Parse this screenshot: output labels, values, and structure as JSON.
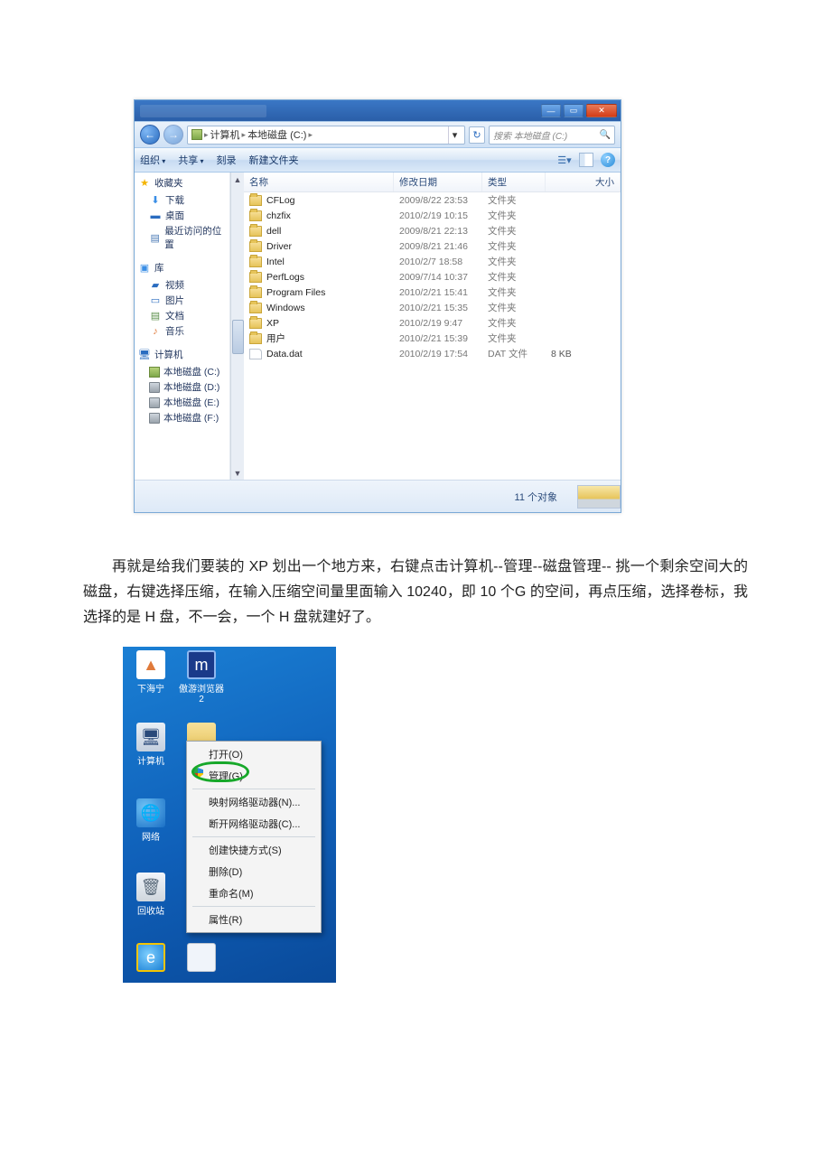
{
  "explorer": {
    "window_controls": {
      "min": "—",
      "max": "▭",
      "close": "✕"
    },
    "nav": {
      "back": "←",
      "forward": "→"
    },
    "breadcrumb": {
      "sep": "▸",
      "seg_computer": "计算机",
      "seg_drive": "本地磁盘 (C:)",
      "seg_trail": "▸",
      "dropdown": "▾",
      "refresh": "↻"
    },
    "search": {
      "placeholder": "搜索 本地磁盘 (C:)",
      "icon": "🔍"
    },
    "toolbar": {
      "organize": "组织",
      "share": "共享",
      "burn": "刻录",
      "new_folder": "新建文件夹",
      "view_icon": "☰▾",
      "help_icon": "?"
    },
    "nav_pane": {
      "favorites": {
        "label": "收藏夹",
        "items": [
          "下载",
          "桌面",
          "最近访问的位置"
        ]
      },
      "libraries": {
        "label": "库",
        "items": [
          "视频",
          "图片",
          "文档",
          "音乐"
        ]
      },
      "computer": {
        "label": "计算机",
        "drives": [
          "本地磁盘 (C:)",
          "本地磁盘 (D:)",
          "本地磁盘 (E:)",
          "本地磁盘 (F:)"
        ]
      }
    },
    "columns": {
      "name": "名称",
      "date": "修改日期",
      "type": "类型",
      "size": "大小"
    },
    "rows": [
      {
        "name": "CFLog",
        "date": "2009/8/22 23:53",
        "type": "文件夹",
        "size": "",
        "kind": "folder"
      },
      {
        "name": "chzfix",
        "date": "2010/2/19 10:15",
        "type": "文件夹",
        "size": "",
        "kind": "folder"
      },
      {
        "name": "dell",
        "date": "2009/8/21 22:13",
        "type": "文件夹",
        "size": "",
        "kind": "folder"
      },
      {
        "name": "Driver",
        "date": "2009/8/21 21:46",
        "type": "文件夹",
        "size": "",
        "kind": "folder"
      },
      {
        "name": "Intel",
        "date": "2010/2/7 18:58",
        "type": "文件夹",
        "size": "",
        "kind": "folder"
      },
      {
        "name": "PerfLogs",
        "date": "2009/7/14 10:37",
        "type": "文件夹",
        "size": "",
        "kind": "folder"
      },
      {
        "name": "Program Files",
        "date": "2010/2/21 15:41",
        "type": "文件夹",
        "size": "",
        "kind": "folder"
      },
      {
        "name": "Windows",
        "date": "2010/2/21 15:35",
        "type": "文件夹",
        "size": "",
        "kind": "folder"
      },
      {
        "name": "XP",
        "date": "2010/2/19 9:47",
        "type": "文件夹",
        "size": "",
        "kind": "folder"
      },
      {
        "name": "用户",
        "date": "2010/2/21 15:39",
        "type": "文件夹",
        "size": "",
        "kind": "folder"
      },
      {
        "name": "Data.dat",
        "date": "2010/2/19 17:54",
        "type": "DAT 文件",
        "size": "8 KB",
        "kind": "file"
      }
    ],
    "status": "11 个对象"
  },
  "paragraph": "再就是给我们要装的 XP 划出一个地方来，右键点击计算机--管理--磁盘管理-- 挑一个剩余空间大的磁盘，右键选择压缩，在输入压缩空间量里面输入 10240，即 10 个G 的空间，再点压缩，选择卷标，我选择的是 H 盘，不一会，一个 H 盘就建好了。",
  "desktop": {
    "icons": {
      "i1": "下海宁",
      "i1b": "傲游浏览器2",
      "i2": "计算机",
      "i3": "网络",
      "i4": "回收站"
    },
    "context_menu": {
      "open": "打开(O)",
      "manage": "管理(G)",
      "map": "映射网络驱动器(N)...",
      "unmap": "断开网络驱动器(C)...",
      "shortcut": "创建快捷方式(S)",
      "delete": "删除(D)",
      "rename": "重命名(M)",
      "props": "属性(R)"
    }
  }
}
